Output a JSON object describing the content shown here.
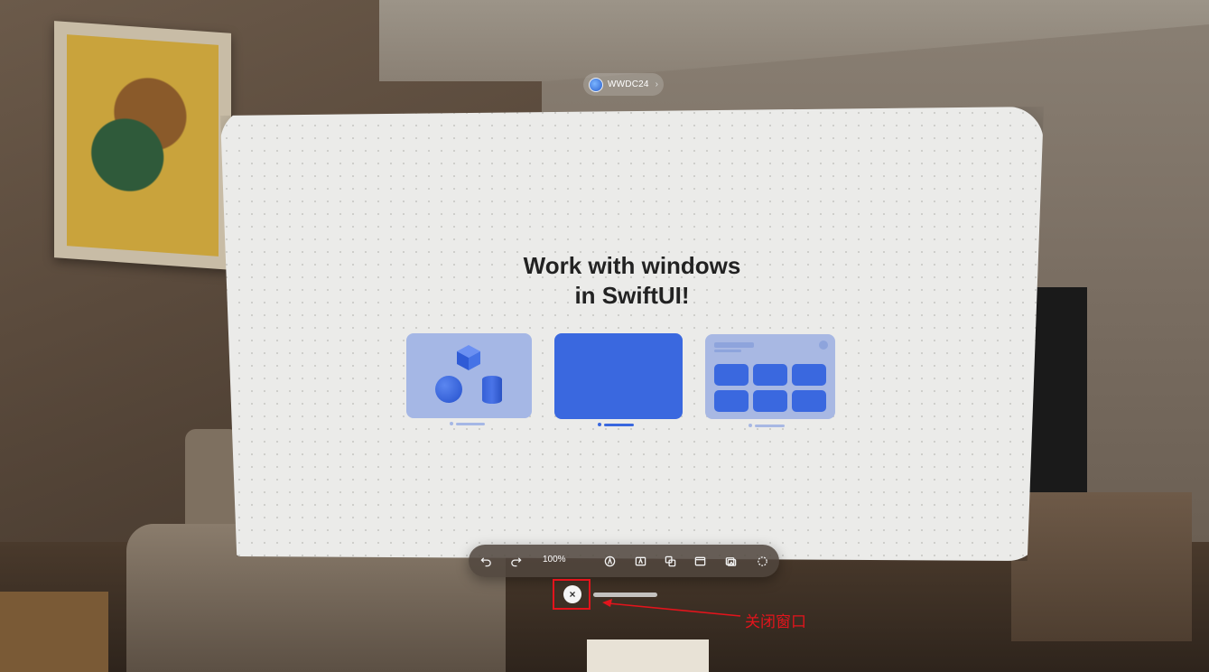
{
  "app_badge": {
    "label": "WWDC24",
    "icon": "app-icon",
    "chevron": "›"
  },
  "window": {
    "headline_line1": "Work with windows",
    "headline_line2": "in SwiftUI!",
    "cards": [
      {
        "kind": "volumes",
        "icon": "3d-shapes"
      },
      {
        "kind": "window",
        "icon": "plain-window"
      },
      {
        "kind": "ornament",
        "icon": "grid-tiles"
      }
    ]
  },
  "toolbar": {
    "zoom": "100%",
    "buttons": [
      "undo-icon",
      "redo-icon",
      "pen-icon",
      "text-box-icon",
      "shapes-icon",
      "window-icon",
      "media-icon",
      "lasso-icon"
    ]
  },
  "window_controls": {
    "close_symbol": "×"
  },
  "annotation": {
    "label": "关闭窗口",
    "color": "#e3141c"
  },
  "colors": {
    "accent": "#3a68df",
    "card_light": "#a5b7e5",
    "canvas": "#ebebe9"
  }
}
